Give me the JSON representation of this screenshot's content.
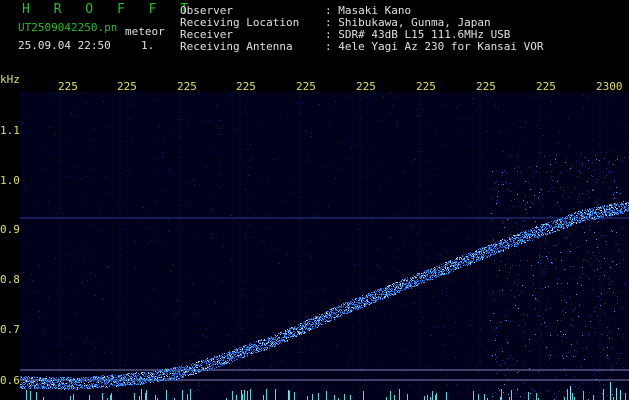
{
  "header": {
    "app_name": "H R O F F T",
    "filename": "UT2509042250.pn",
    "tag": "meteor",
    "datetime": "25.09.04 22:50",
    "index": "1.",
    "info": [
      {
        "label": "Observer",
        "value": ": Masaki Kano"
      },
      {
        "label": "Receiving Location",
        "value": ": Shibukawa, Gunma, Japan"
      },
      {
        "label": "Receiver",
        "value": ": SDR# 43dB L15 111.6MHz USB"
      },
      {
        "label": "Receiving Antenna",
        "value": ": 4ele Yagi Az 230 for Kansai VOR"
      }
    ]
  },
  "axes": {
    "y_unit": "kHz",
    "x_ticks": [
      "225",
      "225",
      "225",
      "225",
      "225",
      "225",
      "225",
      "225",
      "225",
      "2300"
    ],
    "y_ticks": [
      "1.1",
      "1.0",
      "0.9",
      "0.8",
      "0.7",
      "0.6"
    ]
  },
  "colors": {
    "header_green": "#20c020",
    "header_white": "#e0e0e0",
    "tick_yellow": "#e0e060",
    "trace_blue": "#3aa0ff",
    "background": "#000000"
  }
}
